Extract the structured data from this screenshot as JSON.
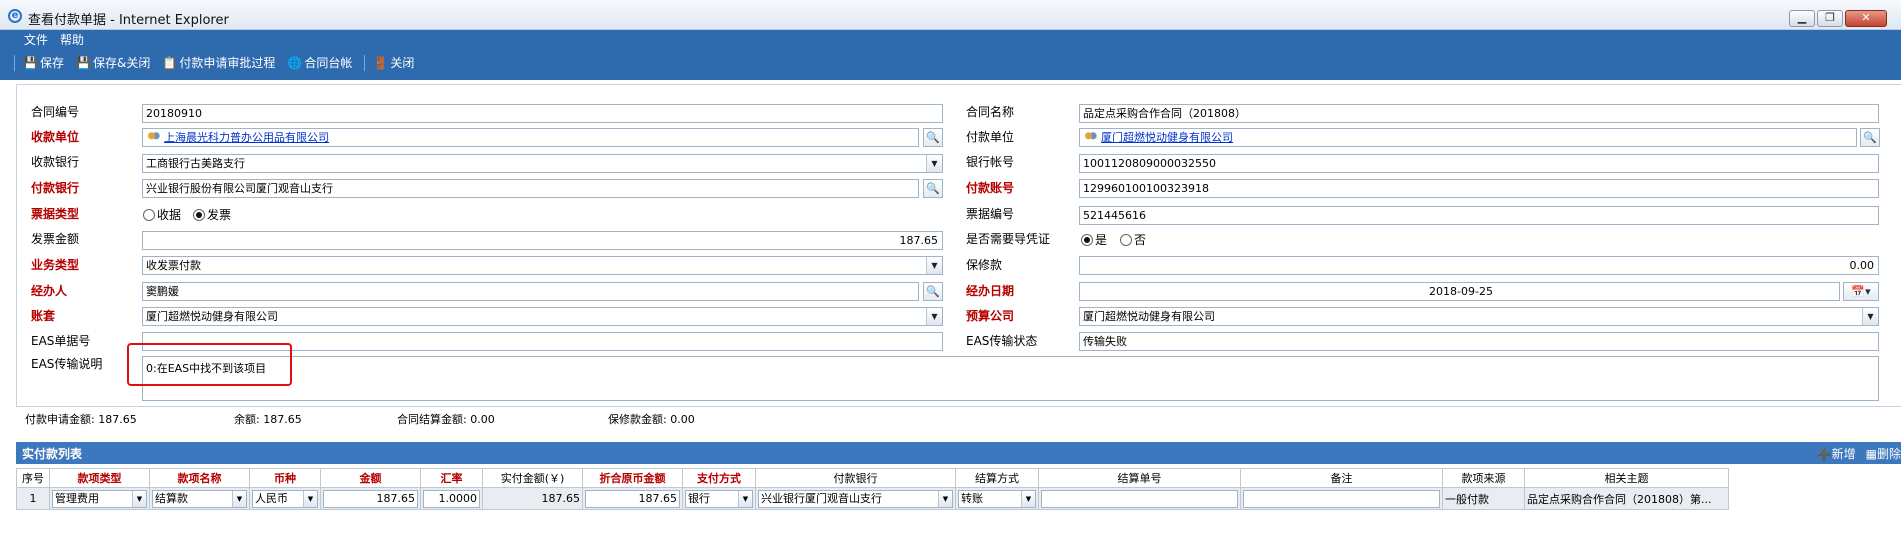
{
  "window": {
    "title": "查看付款单据 - Internet Explorer",
    "minimize": "▁",
    "restore": "❐",
    "close": "✕"
  },
  "menu": [
    "文件",
    "帮助"
  ],
  "toolbar": {
    "save": "保存",
    "save_close": "保存&关闭",
    "approval_process": "付款申请审批过程",
    "contract_ledger": "合同台帐",
    "close": "关闭"
  },
  "form": {
    "contract_no": {
      "label": "合同编号",
      "value": "20180910"
    },
    "contract_name": {
      "label": "合同名称",
      "value": "品定点采购合作合同（201808）"
    },
    "payee_unit": {
      "label": "收款单位",
      "value": "上海晨光科力普办公用品有限公司"
    },
    "payer_unit": {
      "label": "付款单位",
      "value": "厦门超燃悦动健身有限公司"
    },
    "payee_bank": {
      "label": "收款银行",
      "value": "工商银行古美路支行"
    },
    "bank_account": {
      "label": "银行帐号",
      "value": "1001120809000032550"
    },
    "payer_bank": {
      "label": "付款银行",
      "value": "兴业银行股份有限公司厦门观音山支行"
    },
    "payer_account": {
      "label": "付款账号",
      "value": "129960100100323918"
    },
    "bill_type": {
      "label": "票据类型",
      "options": [
        "收据",
        "发票"
      ],
      "selected": "发票"
    },
    "bill_no": {
      "label": "票据编号",
      "value": "521445616"
    },
    "invoice_amount": {
      "label": "发票金额",
      "value": "187.65"
    },
    "need_voucher": {
      "label": "是否需要导凭证",
      "options": [
        "是",
        "否"
      ],
      "selected": "是"
    },
    "business_type": {
      "label": "业务类型",
      "value": "收发票付款"
    },
    "retention": {
      "label": "保修款",
      "value": "0.00"
    },
    "handler": {
      "label": "经办人",
      "value": "窦鹏媛"
    },
    "handle_date": {
      "label": "经办日期",
      "value": "2018-09-25"
    },
    "ledger": {
      "label": "账套",
      "value": "厦门超燃悦动健身有限公司"
    },
    "budget_company": {
      "label": "预算公司",
      "value": "厦门超燃悦动健身有限公司"
    },
    "eas_doc_no": {
      "label": "EAS单据号",
      "value": ""
    },
    "eas_status": {
      "label": "EAS传输状态",
      "value": "传输失败"
    },
    "eas_desc": {
      "label": "EAS传输说明",
      "value": "0:在EAS中找不到该项目"
    }
  },
  "summary": {
    "apply_amount": "付款申请金额: 187.65",
    "balance": "余额: 187.65",
    "settle_amount": "合同结算金额: 0.00",
    "retention_amount": "保修款金额: 0.00"
  },
  "grid": {
    "title": "实付款列表",
    "add": "新增",
    "delete": "删除",
    "columns": [
      "序号",
      "款项类型",
      "款项名称",
      "币种",
      "金额",
      "汇率",
      "实付金额(￥)",
      "折合原币金额",
      "支付方式",
      "付款银行",
      "结算方式",
      "结算单号",
      "备注",
      "款项来源",
      "相关主题"
    ],
    "rows": [
      [
        "1",
        "管理费用",
        "结算款",
        "人民币",
        "187.65",
        "1.0000",
        "187.65",
        "187.65",
        "银行",
        "兴业银行厦门观音山支行",
        "转账",
        "",
        "",
        "一般付款",
        "品定点采购合作合同（201808）第..."
      ]
    ]
  },
  "colors": {
    "title_bar": "#dfe8f3",
    "toolbar_bg": "#2e6aae",
    "grid_header_bg": "#3d77bd",
    "required_label": "#b50000",
    "highlight_box": "#e01010"
  }
}
